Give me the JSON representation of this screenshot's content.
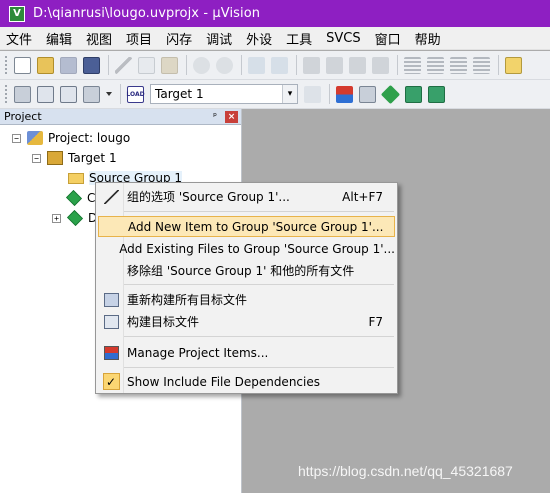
{
  "window": {
    "title": "D:\\qianrusi\\lougo.uvprojx - µVision",
    "app_icon": "uv-icon",
    "app_icon_glyph": "V"
  },
  "menubar": {
    "items": [
      "文件",
      "编辑",
      "视图",
      "项目",
      "闪存",
      "调试",
      "外设",
      "工具",
      "SVCS",
      "窗口",
      "帮助"
    ]
  },
  "toolbar2": {
    "load_label": "LOAD",
    "target_select": "Target 1"
  },
  "project_pane": {
    "title": "Project",
    "pin_glyph": "ᵖ",
    "close_glyph": "×",
    "tree": {
      "project_label": "Project: lougo",
      "target_label": "Target 1",
      "group_label": "Source Group 1",
      "child1_partial": "C",
      "child2_partial": "D",
      "collapse_glyph": "−",
      "expand_glyph": "+"
    }
  },
  "context_menu": {
    "items": [
      {
        "label": "组的选项 'Source Group 1'...",
        "shortcut": "Alt+F7",
        "icon": "wand-icon"
      },
      {
        "label": "Add New  Item to Group 'Source Group 1'...",
        "shortcut": "",
        "highlighted": true
      },
      {
        "label": "Add Existing Files to Group 'Source Group 1'...",
        "shortcut": ""
      },
      {
        "label": "移除组 'Source Group 1' 和他的所有文件",
        "shortcut": ""
      },
      {
        "label": "重新构建所有目标文件",
        "shortcut": "",
        "icon": "rebuild-icon"
      },
      {
        "label": "构建目标文件",
        "shortcut": "F7",
        "icon": "build-icon"
      },
      {
        "label": "Manage Project Items...",
        "shortcut": "",
        "icon": "manage-items-icon"
      },
      {
        "label": "Show Include File Dependencies",
        "shortcut": "",
        "icon": "checked-icon",
        "checked": true,
        "check_glyph": "✓"
      }
    ]
  },
  "watermark": "https://blog.csdn.net/qq_45321687",
  "colors": {
    "titlebar": "#8e1fc2",
    "highlight": "#fce8b7",
    "highlight_border": "#e8b34a"
  }
}
